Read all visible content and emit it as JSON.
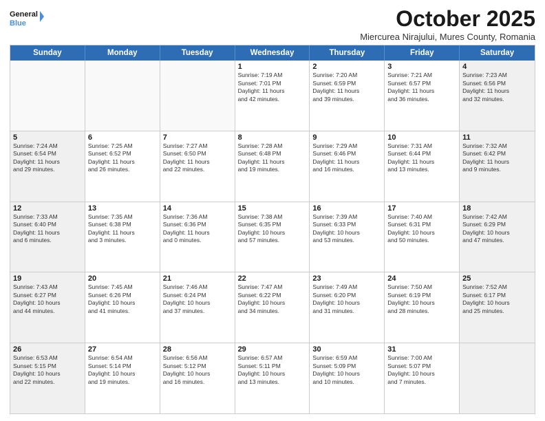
{
  "logo": {
    "line1": "General",
    "line2": "Blue"
  },
  "title": "October 2025",
  "location": "Miercurea Nirajului, Mures County, Romania",
  "header_days": [
    "Sunday",
    "Monday",
    "Tuesday",
    "Wednesday",
    "Thursday",
    "Friday",
    "Saturday"
  ],
  "rows": [
    [
      {
        "day": "",
        "text": "",
        "empty": true
      },
      {
        "day": "",
        "text": "",
        "empty": true
      },
      {
        "day": "",
        "text": "",
        "empty": true
      },
      {
        "day": "1",
        "text": "Sunrise: 7:19 AM\nSunset: 7:01 PM\nDaylight: 11 hours\nand 42 minutes.",
        "empty": false
      },
      {
        "day": "2",
        "text": "Sunrise: 7:20 AM\nSunset: 6:59 PM\nDaylight: 11 hours\nand 39 minutes.",
        "empty": false
      },
      {
        "day": "3",
        "text": "Sunrise: 7:21 AM\nSunset: 6:57 PM\nDaylight: 11 hours\nand 36 minutes.",
        "empty": false
      },
      {
        "day": "4",
        "text": "Sunrise: 7:23 AM\nSunset: 6:56 PM\nDaylight: 11 hours\nand 32 minutes.",
        "empty": false,
        "shaded": true
      }
    ],
    [
      {
        "day": "5",
        "text": "Sunrise: 7:24 AM\nSunset: 6:54 PM\nDaylight: 11 hours\nand 29 minutes.",
        "empty": false,
        "shaded": true
      },
      {
        "day": "6",
        "text": "Sunrise: 7:25 AM\nSunset: 6:52 PM\nDaylight: 11 hours\nand 26 minutes.",
        "empty": false
      },
      {
        "day": "7",
        "text": "Sunrise: 7:27 AM\nSunset: 6:50 PM\nDaylight: 11 hours\nand 22 minutes.",
        "empty": false
      },
      {
        "day": "8",
        "text": "Sunrise: 7:28 AM\nSunset: 6:48 PM\nDaylight: 11 hours\nand 19 minutes.",
        "empty": false
      },
      {
        "day": "9",
        "text": "Sunrise: 7:29 AM\nSunset: 6:46 PM\nDaylight: 11 hours\nand 16 minutes.",
        "empty": false
      },
      {
        "day": "10",
        "text": "Sunrise: 7:31 AM\nSunset: 6:44 PM\nDaylight: 11 hours\nand 13 minutes.",
        "empty": false
      },
      {
        "day": "11",
        "text": "Sunrise: 7:32 AM\nSunset: 6:42 PM\nDaylight: 11 hours\nand 9 minutes.",
        "empty": false,
        "shaded": true
      }
    ],
    [
      {
        "day": "12",
        "text": "Sunrise: 7:33 AM\nSunset: 6:40 PM\nDaylight: 11 hours\nand 6 minutes.",
        "empty": false,
        "shaded": true
      },
      {
        "day": "13",
        "text": "Sunrise: 7:35 AM\nSunset: 6:38 PM\nDaylight: 11 hours\nand 3 minutes.",
        "empty": false
      },
      {
        "day": "14",
        "text": "Sunrise: 7:36 AM\nSunset: 6:36 PM\nDaylight: 11 hours\nand 0 minutes.",
        "empty": false
      },
      {
        "day": "15",
        "text": "Sunrise: 7:38 AM\nSunset: 6:35 PM\nDaylight: 10 hours\nand 57 minutes.",
        "empty": false
      },
      {
        "day": "16",
        "text": "Sunrise: 7:39 AM\nSunset: 6:33 PM\nDaylight: 10 hours\nand 53 minutes.",
        "empty": false
      },
      {
        "day": "17",
        "text": "Sunrise: 7:40 AM\nSunset: 6:31 PM\nDaylight: 10 hours\nand 50 minutes.",
        "empty": false
      },
      {
        "day": "18",
        "text": "Sunrise: 7:42 AM\nSunset: 6:29 PM\nDaylight: 10 hours\nand 47 minutes.",
        "empty": false,
        "shaded": true
      }
    ],
    [
      {
        "day": "19",
        "text": "Sunrise: 7:43 AM\nSunset: 6:27 PM\nDaylight: 10 hours\nand 44 minutes.",
        "empty": false,
        "shaded": true
      },
      {
        "day": "20",
        "text": "Sunrise: 7:45 AM\nSunset: 6:26 PM\nDaylight: 10 hours\nand 41 minutes.",
        "empty": false
      },
      {
        "day": "21",
        "text": "Sunrise: 7:46 AM\nSunset: 6:24 PM\nDaylight: 10 hours\nand 37 minutes.",
        "empty": false
      },
      {
        "day": "22",
        "text": "Sunrise: 7:47 AM\nSunset: 6:22 PM\nDaylight: 10 hours\nand 34 minutes.",
        "empty": false
      },
      {
        "day": "23",
        "text": "Sunrise: 7:49 AM\nSunset: 6:20 PM\nDaylight: 10 hours\nand 31 minutes.",
        "empty": false
      },
      {
        "day": "24",
        "text": "Sunrise: 7:50 AM\nSunset: 6:19 PM\nDaylight: 10 hours\nand 28 minutes.",
        "empty": false
      },
      {
        "day": "25",
        "text": "Sunrise: 7:52 AM\nSunset: 6:17 PM\nDaylight: 10 hours\nand 25 minutes.",
        "empty": false,
        "shaded": true
      }
    ],
    [
      {
        "day": "26",
        "text": "Sunrise: 6:53 AM\nSunset: 5:15 PM\nDaylight: 10 hours\nand 22 minutes.",
        "empty": false,
        "shaded": true
      },
      {
        "day": "27",
        "text": "Sunrise: 6:54 AM\nSunset: 5:14 PM\nDaylight: 10 hours\nand 19 minutes.",
        "empty": false
      },
      {
        "day": "28",
        "text": "Sunrise: 6:56 AM\nSunset: 5:12 PM\nDaylight: 10 hours\nand 16 minutes.",
        "empty": false
      },
      {
        "day": "29",
        "text": "Sunrise: 6:57 AM\nSunset: 5:11 PM\nDaylight: 10 hours\nand 13 minutes.",
        "empty": false
      },
      {
        "day": "30",
        "text": "Sunrise: 6:59 AM\nSunset: 5:09 PM\nDaylight: 10 hours\nand 10 minutes.",
        "empty": false
      },
      {
        "day": "31",
        "text": "Sunrise: 7:00 AM\nSunset: 5:07 PM\nDaylight: 10 hours\nand 7 minutes.",
        "empty": false
      },
      {
        "day": "",
        "text": "",
        "empty": true,
        "shaded": true
      }
    ]
  ]
}
